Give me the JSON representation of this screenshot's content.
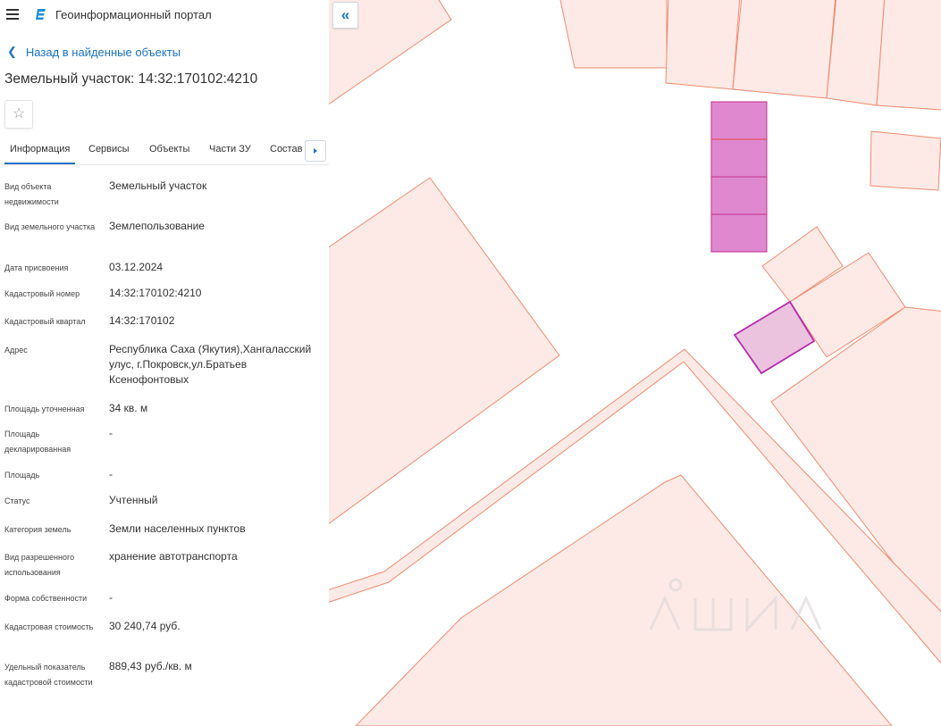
{
  "header": {
    "app_title": "Геоинформационный портал"
  },
  "nav": {
    "back_label": "Назад в найденные объекты"
  },
  "object": {
    "title": "Земельный участок: 14:32:170102:4210"
  },
  "tabs": [
    {
      "label": "Информация",
      "active": true
    },
    {
      "label": "Сервисы",
      "active": false
    },
    {
      "label": "Объекты",
      "active": false
    },
    {
      "label": "Части ЗУ",
      "active": false
    },
    {
      "label": "Состав",
      "active": false
    }
  ],
  "properties": [
    {
      "label": "Вид объекта недвижимости",
      "value": "Земельный участок"
    },
    {
      "label": "Вид земельного участка",
      "value": "Землепользование"
    },
    {
      "label": "Дата присвоения",
      "value": "03.12.2024"
    },
    {
      "label": "Кадастровый номер",
      "value": "14:32:170102:4210"
    },
    {
      "label": "Кадастровый квартал",
      "value": "14:32:170102"
    },
    {
      "label": "Адрес",
      "value": "Республика Саха (Якутия),Хангаласский улус, г.Покровск,ул.Братьев Ксенофонтовых"
    },
    {
      "label": "Площадь уточненная",
      "value": "34 кв. м"
    },
    {
      "label": "Площадь декларированная",
      "value": "-"
    },
    {
      "label": "Площадь",
      "value": "-"
    },
    {
      "label": "Статус",
      "value": "Учтенный"
    },
    {
      "label": "Категория земель",
      "value": "Земли населенных пунктов"
    },
    {
      "label": "Вид разрешенного использования",
      "value": "хранение автотранспорта"
    },
    {
      "label": "Форма собственности",
      "value": "-"
    },
    {
      "label": "Кадастровая стоимость",
      "value": "30 240,74 руб."
    },
    {
      "label": "Удельный показатель кадастровой стоимости",
      "value": "889,43 руб./кв. м"
    }
  ],
  "colors": {
    "accent": "#1a73c8",
    "parcel_fill": "#fdeae6",
    "parcel_stroke": "#f08a70",
    "highlight_fill": "#df88d0",
    "highlight_stroke": "#c0308f",
    "selected_fill": "#ebc3df",
    "selected_stroke": "#b62bb0"
  },
  "icons": {
    "menu": "menu-icon",
    "logo": "logo-icon",
    "back": "chevron-left-icon",
    "favorite": "star-icon",
    "tab_scroll": "caret-right-icon",
    "collapse": "double-chevron-left-icon"
  }
}
